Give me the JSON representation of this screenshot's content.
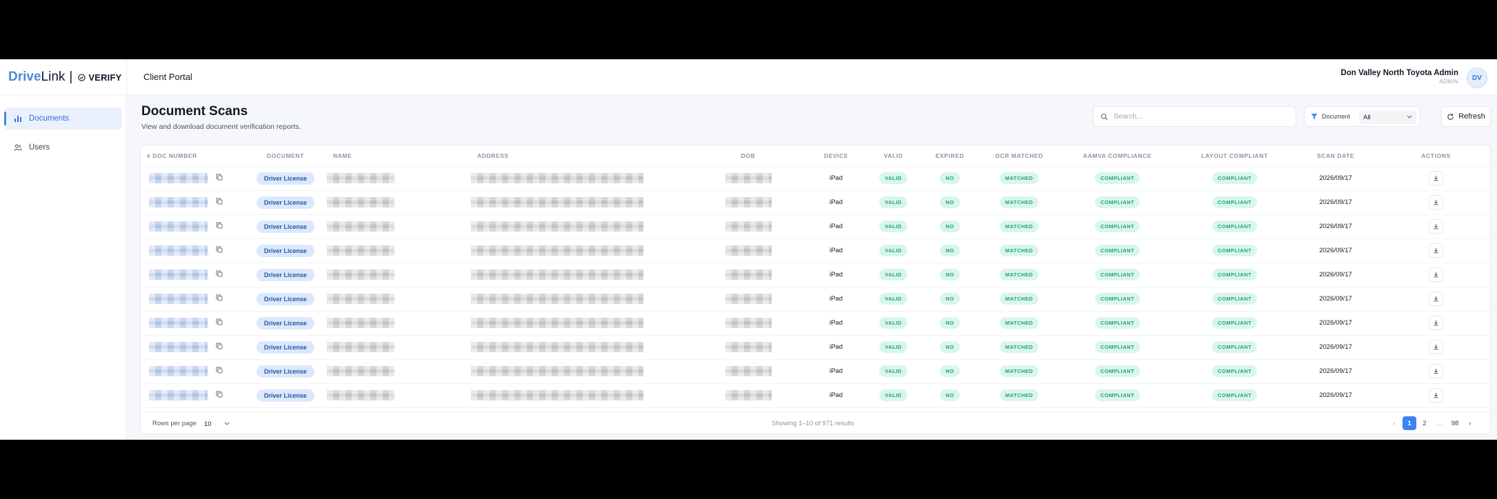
{
  "brand": {
    "part1": "Drive",
    "part2": "Link",
    "separator": "|",
    "product": "VERIFY"
  },
  "header": {
    "portal_title": "Client Portal",
    "user_name": "Don Valley North Toyota Admin",
    "user_role": "ADMIN",
    "avatar_initials": "DV"
  },
  "sidebar": {
    "items": [
      {
        "label": "Documents",
        "icon": "bar-chart-icon",
        "active": true
      },
      {
        "label": "Users",
        "icon": "users-icon",
        "active": false
      }
    ]
  },
  "page": {
    "title": "Document Scans",
    "subtitle": "View and download document verification reports."
  },
  "toolbar": {
    "search_placeholder": "Search...",
    "filter_label": "Document",
    "filter_value": "All",
    "refresh_label": "Refresh"
  },
  "table": {
    "columns": [
      "# DOC NUMBER",
      "DOCUMENT",
      "NAME",
      "ADDRESS",
      "DOB",
      "DEVICE",
      "VALID",
      "EXPIRED",
      "OCR MATCHED",
      "AAMVA COMPLIANCE",
      "LAYOUT COMPLIANT",
      "SCAN DATE",
      "ACTIONS"
    ],
    "rows": [
      {
        "document": "Driver License",
        "device": "iPad",
        "valid": "VALID",
        "expired": "NO",
        "ocr": "MATCHED",
        "aamva": "COMPLIANT",
        "layout": "COMPLIANT",
        "scan_date": "2026/09/17"
      },
      {
        "document": "Driver License",
        "device": "iPad",
        "valid": "VALID",
        "expired": "NO",
        "ocr": "MATCHED",
        "aamva": "COMPLIANT",
        "layout": "COMPLIANT",
        "scan_date": "2026/09/17"
      },
      {
        "document": "Driver License",
        "device": "iPad",
        "valid": "VALID",
        "expired": "NO",
        "ocr": "MATCHED",
        "aamva": "COMPLIANT",
        "layout": "COMPLIANT",
        "scan_date": "2026/09/17"
      },
      {
        "document": "Driver License",
        "device": "iPad",
        "valid": "VALID",
        "expired": "NO",
        "ocr": "MATCHED",
        "aamva": "COMPLIANT",
        "layout": "COMPLIANT",
        "scan_date": "2026/09/17"
      },
      {
        "document": "Driver License",
        "device": "iPad",
        "valid": "VALID",
        "expired": "NO",
        "ocr": "MATCHED",
        "aamva": "COMPLIANT",
        "layout": "COMPLIANT",
        "scan_date": "2026/09/17"
      },
      {
        "document": "Driver License",
        "device": "iPad",
        "valid": "VALID",
        "expired": "NO",
        "ocr": "MATCHED",
        "aamva": "COMPLIANT",
        "layout": "COMPLIANT",
        "scan_date": "2026/09/17"
      },
      {
        "document": "Driver License",
        "device": "iPad",
        "valid": "VALID",
        "expired": "NO",
        "ocr": "MATCHED",
        "aamva": "COMPLIANT",
        "layout": "COMPLIANT",
        "scan_date": "2026/09/17"
      },
      {
        "document": "Driver License",
        "device": "iPad",
        "valid": "VALID",
        "expired": "NO",
        "ocr": "MATCHED",
        "aamva": "COMPLIANT",
        "layout": "COMPLIANT",
        "scan_date": "2026/09/17"
      },
      {
        "document": "Driver License",
        "device": "iPad",
        "valid": "VALID",
        "expired": "NO",
        "ocr": "MATCHED",
        "aamva": "COMPLIANT",
        "layout": "COMPLIANT",
        "scan_date": "2026/09/17"
      },
      {
        "document": "Driver License",
        "device": "iPad",
        "valid": "VALID",
        "expired": "NO",
        "ocr": "MATCHED",
        "aamva": "COMPLIANT",
        "layout": "COMPLIANT",
        "scan_date": "2026/09/17"
      }
    ]
  },
  "footer": {
    "rows_per_page_label": "Rows per page",
    "rows_per_page_value": "10",
    "showing_text": "Showing 1–10 of 971 results",
    "prev": "‹",
    "next": "›",
    "pages": [
      "1",
      "2",
      "...",
      "98"
    ],
    "current_page": "1"
  },
  "colors": {
    "brand_blue": "#4a89dc",
    "accent": "#3b82f6",
    "success_bg": "#d9f6ec",
    "success_text": "#1f9f77",
    "chip_bg": "#dce8fb"
  }
}
